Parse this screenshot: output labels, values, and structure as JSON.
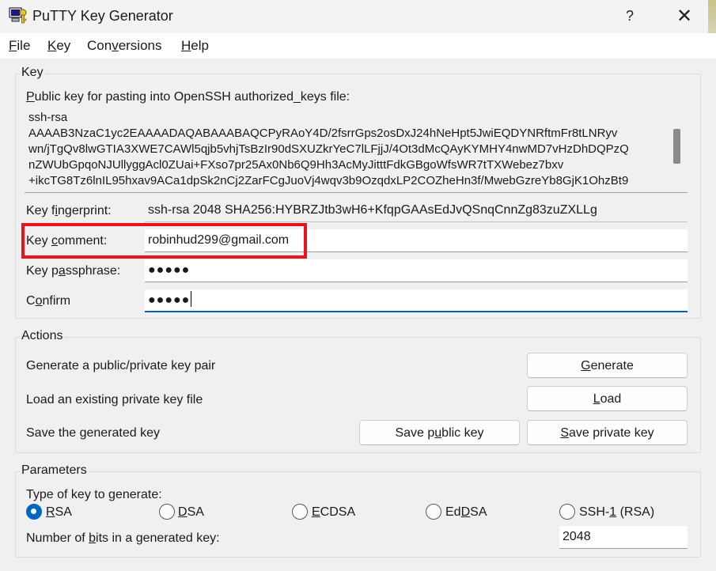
{
  "window": {
    "title": "PuTTY Key Generator",
    "help_glyph": "?",
    "close_glyph": "✕"
  },
  "menu": [
    {
      "pre": "",
      "ul": "F",
      "post": "ile"
    },
    {
      "pre": "",
      "ul": "K",
      "post": "ey"
    },
    {
      "pre": "Con",
      "ul": "v",
      "post": "ersions"
    },
    {
      "pre": "",
      "ul": "H",
      "post": "elp"
    }
  ],
  "key_group": {
    "title": "Key",
    "public_key_label": {
      "pre": "",
      "ul": "P",
      "post": "ublic key for pasting into OpenSSH authorized_keys file:"
    },
    "public_key_text": "ssh-rsa\nAAAAB3NzaC1yc2EAAAADAQABAAABAQCPyRAoY4D/2fsrrGps2osDxJ24hNeHpt5JwiEQDYNRftmFr8tLNRyv\nwn/jTgQv8lwGTIA3XWE7CAWl5qjb5vhjTsBzIr90dSXUZkrYeC7lLFjjJ/4Ot3dMcQAyKYMHY4nwMD7vHzDhDQPzQ\nnZWUbGpqoNJUllyggAcl0ZUai+FXso7pr25Ax0Nb6Q9Hh3AcMyJitttFdkGBgoWfsWR7tTXWebez7bxv\n+ikcTG8Tz6lnIL95hxav9ACa1dpSk2nCj2ZarFCgJuoVj4wqv3b9OzqdxLP2COZheHn3f/MwebGzreYb8GjK1OhzBt9",
    "fingerprint_label": {
      "pre": "Key f",
      "ul": "i",
      "post": "ngerprint:"
    },
    "fingerprint_value": "ssh-rsa 2048 SHA256:HYBRZJtb3wH6+KfqpGAAsEdJvQSnqCnnZg83zuZXLLg",
    "comment_label": {
      "pre": "Key ",
      "ul": "c",
      "post": "omment:"
    },
    "comment_value": "robinhud299@gmail.com",
    "passphrase_label": {
      "pre": "Key p",
      "ul": "a",
      "post": "ssphrase:"
    },
    "passphrase_value": "●●●●●",
    "confirm_label": {
      "pre": "C",
      "ul": "o",
      "post": "nfirm"
    },
    "confirm_value": "●●●●●"
  },
  "actions_group": {
    "title": "Actions",
    "generate_label": "Generate a public/private key pair",
    "generate_button": {
      "pre": "",
      "ul": "G",
      "post": "enerate"
    },
    "load_label": "Load an existing private key file",
    "load_button": {
      "pre": "",
      "ul": "L",
      "post": "oad"
    },
    "save_label": "Save the generated key",
    "save_public_button": {
      "pre": "Save p",
      "ul": "u",
      "post": "blic key"
    },
    "save_private_button": {
      "pre": "",
      "ul": "S",
      "post": "ave private key"
    }
  },
  "parameters_group": {
    "title": "Parameters",
    "type_label": "Type of key to generate:",
    "key_types": [
      {
        "pre": "",
        "ul": "R",
        "post": "SA",
        "checked": true
      },
      {
        "pre": "",
        "ul": "D",
        "post": "SA",
        "checked": false
      },
      {
        "pre": "",
        "ul": "E",
        "post": "CDSA",
        "checked": false
      },
      {
        "pre": "Ed",
        "ul": "D",
        "post": "SA",
        "checked": false
      },
      {
        "pre": "SSH-",
        "ul": "1",
        "post": " (RSA)",
        "checked": false
      }
    ],
    "bits_label": {
      "pre": "Number of ",
      "ul": "b",
      "post": "its in a generated key:"
    },
    "bits_value": "2048"
  },
  "colors": {
    "highlight": "#e8131d",
    "accent": "#0067c0"
  }
}
